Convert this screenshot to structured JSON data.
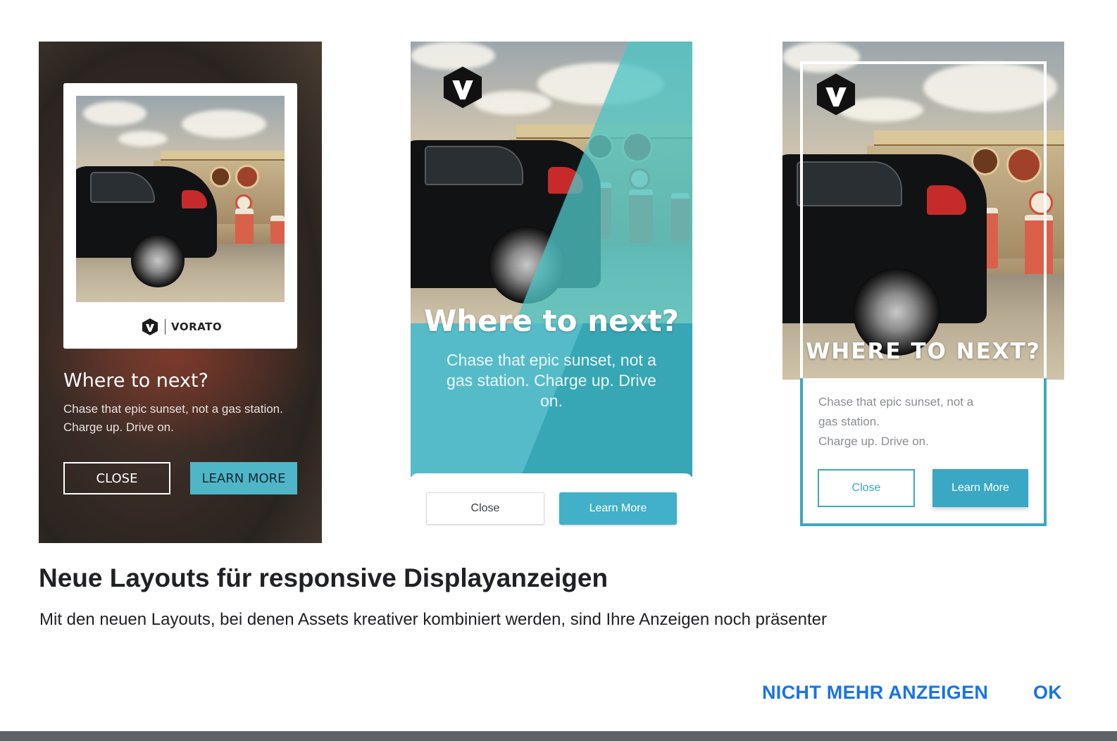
{
  "dialog": {
    "title": "Neue Layouts für responsive Displayanzeigen",
    "subtitle": "Mit den neuen Layouts, bei denen Assets kreativer kombiniert werden, sind Ihre Anzeigen noch präsenter",
    "actions": {
      "dismiss_label": "NICHT MEHR ANZEIGEN",
      "ok_label": "OK"
    },
    "accent_color": "#1a73e8"
  },
  "previews": [
    {
      "brand_name": "VORATO",
      "headline": "Where to next?",
      "body": "Chase that epic sunset, not a gas station. Charge up. Drive on.",
      "close_label": "CLOSE",
      "learn_label": "LEARN MORE",
      "accent_color": "#4fb6c8"
    },
    {
      "headline": "Where to next?",
      "body": "Chase that epic sunset, not a gas station. Charge up. Drive on.",
      "close_label": "Close",
      "learn_label": "Learn More",
      "accent_color": "#42b0c8"
    },
    {
      "headline": "WHERE TO NEXT?",
      "body_lines": [
        "Chase that epic sunset, not a",
        "gas station.",
        "Charge up. Drive on."
      ],
      "close_label": "Close",
      "learn_label": "Learn More",
      "accent_color": "#3aa8c4"
    }
  ],
  "icons": {
    "brand_logo": "vorato-v-logo-icon"
  }
}
